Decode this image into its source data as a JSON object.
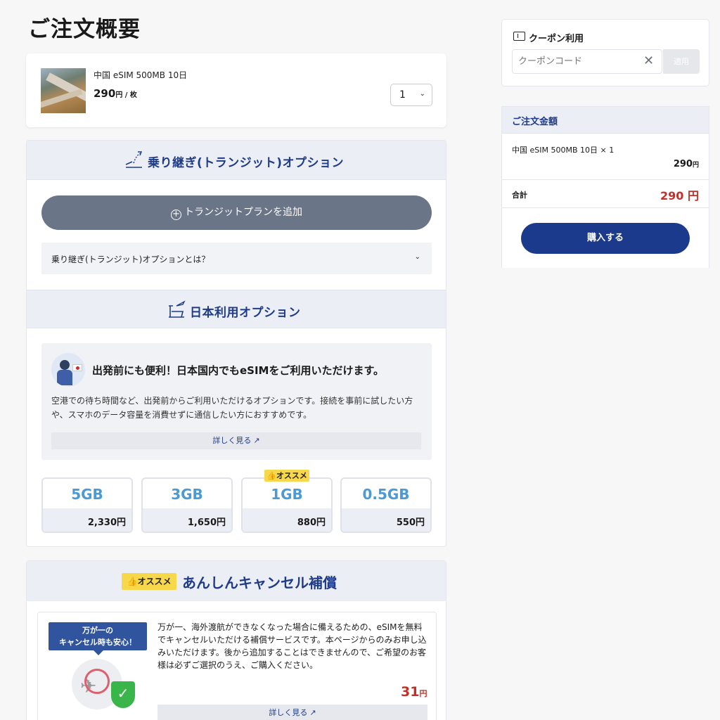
{
  "page": {
    "title": "ご注文概要"
  },
  "product": {
    "name": "中国 eSIM 500MB 10日",
    "price": "290",
    "price_unit": "円 / 枚",
    "quantity": "1"
  },
  "transit": {
    "title": "乗り継ぎ(トランジット)オプション",
    "add_button": "トランジットプランを追加",
    "faq": "乗り継ぎ(トランジット)オプションとは？"
  },
  "japan": {
    "title": "日本利用オプション",
    "heading": "出発前にも便利！日本国内でもeSIMをご利用いただけます。",
    "desc": "空港での待ち時間など、出発前からご利用いただけるオプションです。接続を事前に試したい方や、スマホのデータ容量を消費せずに通信したい方におすすめです。",
    "details_link": "詳しく見る",
    "recommend": "オススメ",
    "plans": [
      {
        "size": "5GB",
        "price": "2,330円"
      },
      {
        "size": "3GB",
        "price": "1,650円"
      },
      {
        "size": "1GB",
        "price": "880円"
      },
      {
        "size": "0.5GB",
        "price": "550円"
      }
    ]
  },
  "cancel": {
    "badge": "オススメ",
    "title": "あんしんキャンセル補償",
    "banner_line1": "万が一の",
    "banner_line2": "キャンセル時も安心！",
    "desc": "万が一、海外渡航ができなくなった場合に備えるための、eSIMを無料でキャンセルいただける補償サービスです。本ページからのみお申し込みいただけます。後から追加することはできませんので、ご希望のお客様は必ずご選択のうえ、ご購入ください。",
    "price": "31",
    "price_unit": "円",
    "details_link": "詳しく見る"
  },
  "coupon": {
    "title": "クーポン利用",
    "placeholder": "クーポンコード",
    "apply": "適用"
  },
  "summary": {
    "title": "ご注文金額",
    "item": "中国 eSIM 500MB 10日 × 1",
    "item_price": "290",
    "item_unit": "円",
    "total_label": "合計",
    "total": "290 円",
    "purchase": "購入する"
  },
  "colors": {
    "navy": "#1c3a8c",
    "accent_red": "#c3302a",
    "plan_blue": "#4a9ad6",
    "recommend_yellow": "#f7d84a"
  },
  "icons": [
    "transit-icon",
    "japan-airport-icon",
    "plus-circle-icon",
    "chevron-down-icon",
    "external-link-icon",
    "thumbs-up-icon",
    "ticket-icon",
    "close-icon"
  ]
}
